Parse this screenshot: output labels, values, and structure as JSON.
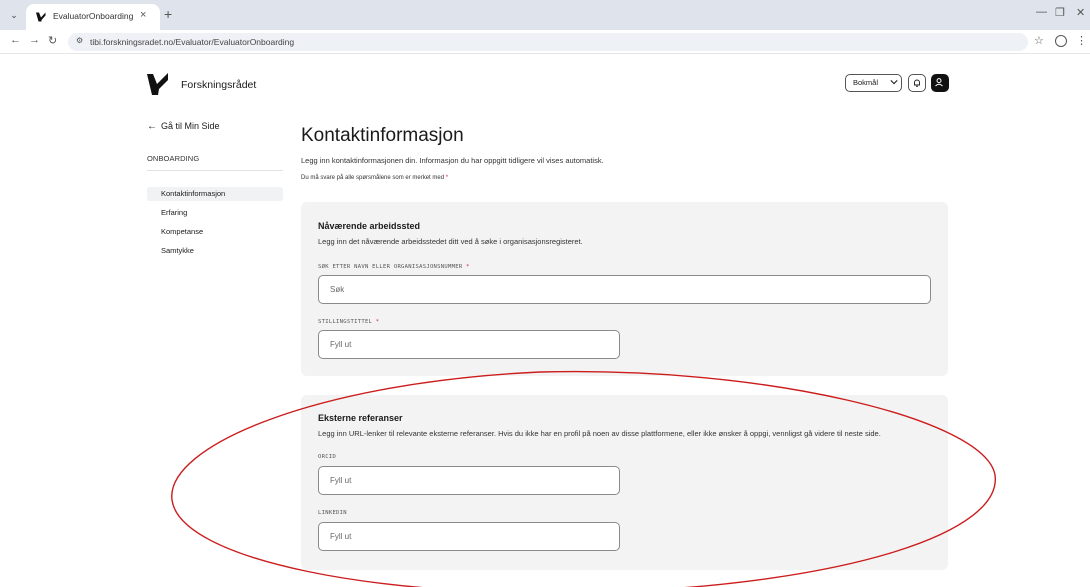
{
  "browser": {
    "tab_title": "EvaluatorOnboarding",
    "url": "tibi.forskningsradet.no/Evaluator/EvaluatorOnboarding"
  },
  "header": {
    "brand_name": "Forskningsrådet",
    "language": "Bokmål"
  },
  "sidebar": {
    "back_label": "Gå til Min Side",
    "section_title": "ONBOARDING",
    "items": [
      {
        "label": "Kontaktinformasjon",
        "active": true
      },
      {
        "label": "Erfaring",
        "active": false
      },
      {
        "label": "Kompetanse",
        "active": false
      },
      {
        "label": "Samtykke",
        "active": false
      }
    ]
  },
  "main": {
    "title": "Kontaktinformasjon",
    "intro": "Legg inn kontaktinformasjonen din. Informasjon du har oppgitt tidligere vil vises automatisk.",
    "required_note": "Du må svare på alle spørsmålene som er merket med",
    "required_mark": "*",
    "workplace": {
      "title": "Nåværende arbeidssted",
      "description": "Legg inn det nåværende arbeidsstedet ditt ved å søke i organisasjonsregisteret.",
      "search_label": "SØK ETTER NAVN ELLER ORGANISASJONSNUMMER",
      "search_placeholder": "Søk",
      "job_label": "STILLINGSTITTEL",
      "job_placeholder": "Fyll ut"
    },
    "references": {
      "title": "Eksterne referanser",
      "description": "Legg inn URL-lenker til relevante eksterne referanser. Hvis du ikke har en profil på noen av disse plattformene, eller ikke ønsker å oppgi, vennligst gå videre til neste side.",
      "orcid_label": "ORCID",
      "orcid_placeholder": "Fyll ut",
      "linkedin_label": "LINKEDIN",
      "linkedin_placeholder": "Fyll ut"
    }
  },
  "colors": {
    "accent_required": "#d3174c",
    "annotation": "#cc1d1d",
    "card_bg": "#f3f3f3"
  }
}
